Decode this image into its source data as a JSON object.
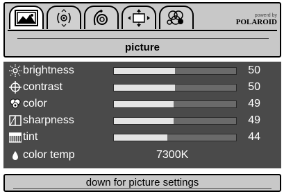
{
  "tabs": [
    {
      "name": "picture-icon",
      "active": true
    },
    {
      "name": "audio-icon",
      "active": false
    },
    {
      "name": "setup-icon",
      "active": false
    },
    {
      "name": "screen-icon",
      "active": false
    },
    {
      "name": "channel-icon",
      "active": false
    }
  ],
  "brand": {
    "small": "powerd by",
    "name": "POLAROID"
  },
  "section_title": "picture",
  "settings": [
    {
      "label": "brightness",
      "value": "50",
      "level": 0.5,
      "icon": "brightness-icon"
    },
    {
      "label": "contrast",
      "value": "50",
      "level": 0.5,
      "icon": "contrast-icon"
    },
    {
      "label": "color",
      "value": "49",
      "level": 0.49,
      "icon": "color-icon"
    },
    {
      "label": "sharpness",
      "value": "49",
      "level": 0.49,
      "icon": "sharpness-icon"
    },
    {
      "label": "tint",
      "value": "44",
      "level": 0.44,
      "icon": "tint-icon"
    },
    {
      "label": "color temp",
      "value": "7300K",
      "icon": "color-temp-icon"
    }
  ],
  "hint": "down for picture settings",
  "colors": {
    "panel": "#c8c8c8",
    "menu_bg": "#4a4a4a",
    "bar_fill": "#e4e4e4",
    "bar_track": "#6a6a6a"
  }
}
